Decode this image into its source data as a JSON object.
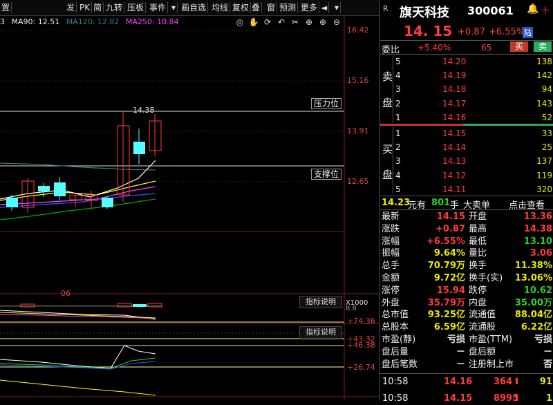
{
  "toolbar": {
    "items": [
      "置",
      "发",
      "PK",
      "简",
      "九转",
      "压板",
      "事件",
      "▾",
      "画自选",
      "均线",
      "复权",
      "叠",
      "窗",
      "预测",
      "更多",
      "◄",
      "▾"
    ]
  },
  "ma": {
    "ma90": "MA90: 12.51",
    "ma120": "MA120: 12.82",
    "ma250": "MA250: 10.84",
    "prefix": "3"
  },
  "price_scale": [
    "16.42",
    "15.16",
    "13.91",
    "12.65"
  ],
  "annotations": {
    "high_label": "14.38",
    "resistance": "压力位",
    "support": "支撑位",
    "date_tick": "06",
    "vol_label": "X1000",
    "vol_val": "8.8"
  },
  "indicators": {
    "btn1": "指标说明",
    "btn2": "指标说明",
    "scale1": [
      "+74.36",
      "+46.38"
    ],
    "scale2": [
      "+43.32",
      "+26.74"
    ]
  },
  "quote": {
    "badge": "R",
    "name": "旗天科技",
    "code": "300061",
    "price": "14. 15",
    "change": "+0.87",
    "pct": "+6.55%",
    "tag": "陆",
    "weibi_label": "委比",
    "weibi": "+5.40%",
    "weicha": "65",
    "buy_btn": "买",
    "sell_btn": "卖"
  },
  "sell_side_label": [
    "卖",
    "盘"
  ],
  "buy_side_label": [
    "买",
    "盘"
  ],
  "sell_orders": [
    {
      "lv": "5",
      "price": "14.20",
      "vol": "138"
    },
    {
      "lv": "4",
      "price": "14.19",
      "vol": "142"
    },
    {
      "lv": "3",
      "price": "14.18",
      "vol": "94"
    },
    {
      "lv": "2",
      "price": "14.17",
      "vol": "143"
    },
    {
      "lv": "1",
      "price": "14.16",
      "vol": "52"
    }
  ],
  "buy_orders": [
    {
      "lv": "1",
      "price": "14.15",
      "vol": "33"
    },
    {
      "lv": "2",
      "price": "14.14",
      "vol": "25"
    },
    {
      "lv": "3",
      "price": "14.13",
      "vol": "137"
    },
    {
      "lv": "4",
      "price": "14.12",
      "vol": "119"
    },
    {
      "lv": "5",
      "price": "14.11",
      "vol": "320"
    }
  ],
  "big_order": {
    "amount": "14.23",
    "amount_unit": "元有",
    "hands": "801",
    "hands_unit": "手",
    "label": "大卖单",
    "link": "点击查看"
  },
  "stats": [
    {
      "l": "最新",
      "v": "14.15",
      "vc": "red",
      "l2": "开盘",
      "v2": "13.36",
      "vc2": "red"
    },
    {
      "l": "涨跌",
      "v": "+0.87",
      "vc": "red",
      "l2": "最高",
      "v2": "14.38",
      "vc2": "red"
    },
    {
      "l": "涨幅",
      "v": "+6.55%",
      "vc": "red",
      "l2": "最低",
      "v2": "13.10",
      "vc2": "green"
    },
    {
      "l": "振幅",
      "v": "9.64%",
      "vc": "yellow",
      "l2": "量比",
      "v2": "3.06",
      "vc2": "red"
    },
    {
      "l": "总手",
      "v": "70.79万",
      "vc": "yellow",
      "l2": "换手",
      "v2": "11.38%",
      "vc2": "yellow"
    },
    {
      "l": "金额",
      "v": "9.72亿",
      "vc": "yellow",
      "l2": "换手(实)",
      "v2": "13.06%",
      "vc2": "yellow"
    },
    {
      "l": "涨停",
      "v": "15.94",
      "vc": "red",
      "l2": "跌停",
      "v2": "10.62",
      "vc2": "green"
    },
    {
      "l": "外盘",
      "v": "35.79万",
      "vc": "red",
      "l2": "内盘",
      "v2": "35.00万",
      "vc2": "green"
    },
    {
      "l": "总市值",
      "v": "93.25亿",
      "vc": "yellow",
      "l2": "流通值",
      "v2": "88.04亿",
      "vc2": "yellow"
    },
    {
      "l": "总股本",
      "v": "6.59亿",
      "vc": "yellow",
      "l2": "流通股",
      "v2": "6.22亿",
      "vc2": "yellow"
    },
    {
      "l": "市盈(静)",
      "v": "亏损",
      "vc": "white",
      "l2": "市盈(TTM)",
      "v2": "亏损",
      "vc2": "white"
    },
    {
      "l": "盘后量",
      "v": "－",
      "vc": "white",
      "l2": "盘后额",
      "v2": "－",
      "vc2": "white"
    },
    {
      "l": "盘后笔数",
      "v": "－",
      "vc": "white",
      "l2": "注册制上市",
      "v2": "否",
      "vc2": "white"
    }
  ],
  "ticks": [
    {
      "time": "10:58",
      "price": "14.16",
      "vol": "364",
      "n": "91"
    },
    {
      "time": "10:58",
      "price": "14.15",
      "vol": "8995",
      "n": "1"
    }
  ],
  "colors": {
    "up": "#ff3b3b",
    "down": "#54ffff",
    "ma_white": "#ffffff",
    "ma_yellow": "#ffff00",
    "ma_magenta": "#ff44ff",
    "ma_green": "#00cc00"
  }
}
